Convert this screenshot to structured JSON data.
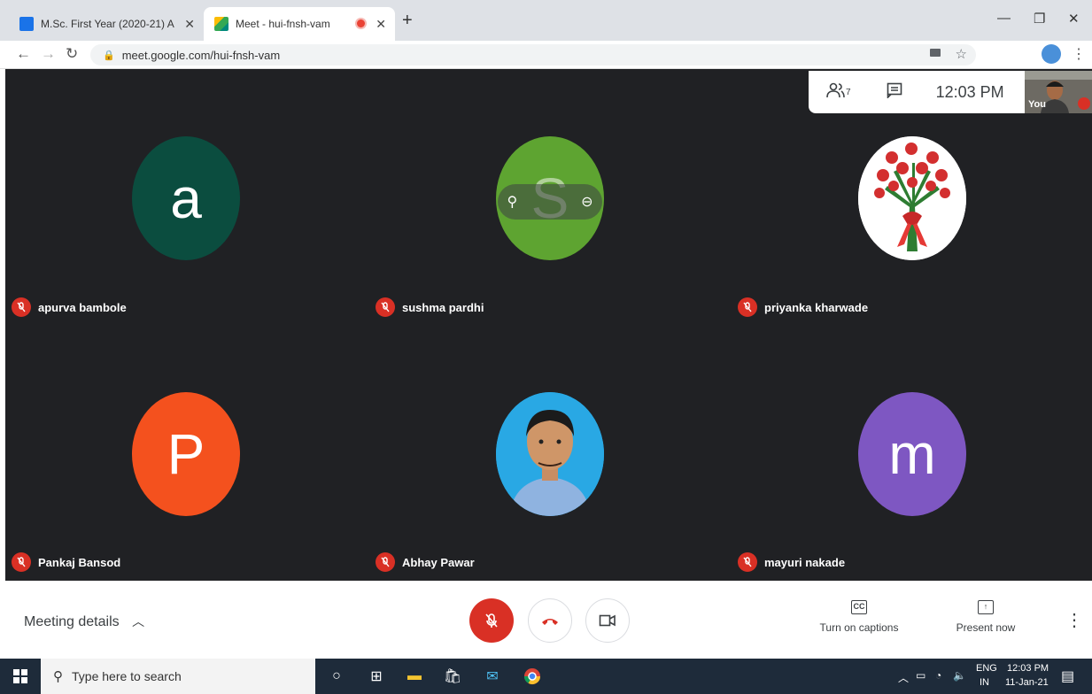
{
  "browser": {
    "tabs": [
      {
        "title": "M.Sc. First Year (2020-21) A",
        "favicon_color": "#1a73e8"
      },
      {
        "title": "Meet - hui-fnsh-vam",
        "favicon_color": "#00897b"
      }
    ],
    "url": "meet.google.com/hui-fnsh-vam"
  },
  "meet": {
    "participant_count": "7",
    "time": "12:03 PM",
    "self_label": "You",
    "participants": [
      {
        "name": "apurva bambole",
        "initial": "a",
        "color": "#0b4d3f"
      },
      {
        "name": "sushma pardhi",
        "initial": "S",
        "color": "#5ea431"
      },
      {
        "name": "priyanka kharwade",
        "initial": "",
        "color": "#ffffff"
      },
      {
        "name": "Pankaj Bansod",
        "initial": "P",
        "color": "#f4511e"
      },
      {
        "name": "Abhay Pawar",
        "initial": "",
        "color": "#1fa3e0"
      },
      {
        "name": "mayuri nakade",
        "initial": "m",
        "color": "#7e57c2"
      }
    ],
    "meeting_details_label": "Meeting details",
    "captions_label": "Turn on captions",
    "captions_icon_text": "CC",
    "present_label": "Present now"
  },
  "taskbar": {
    "search_placeholder": "Type here to search",
    "lang": "ENG",
    "lang_region": "IN",
    "time": "12:03 PM",
    "date": "11-Jan-21"
  }
}
